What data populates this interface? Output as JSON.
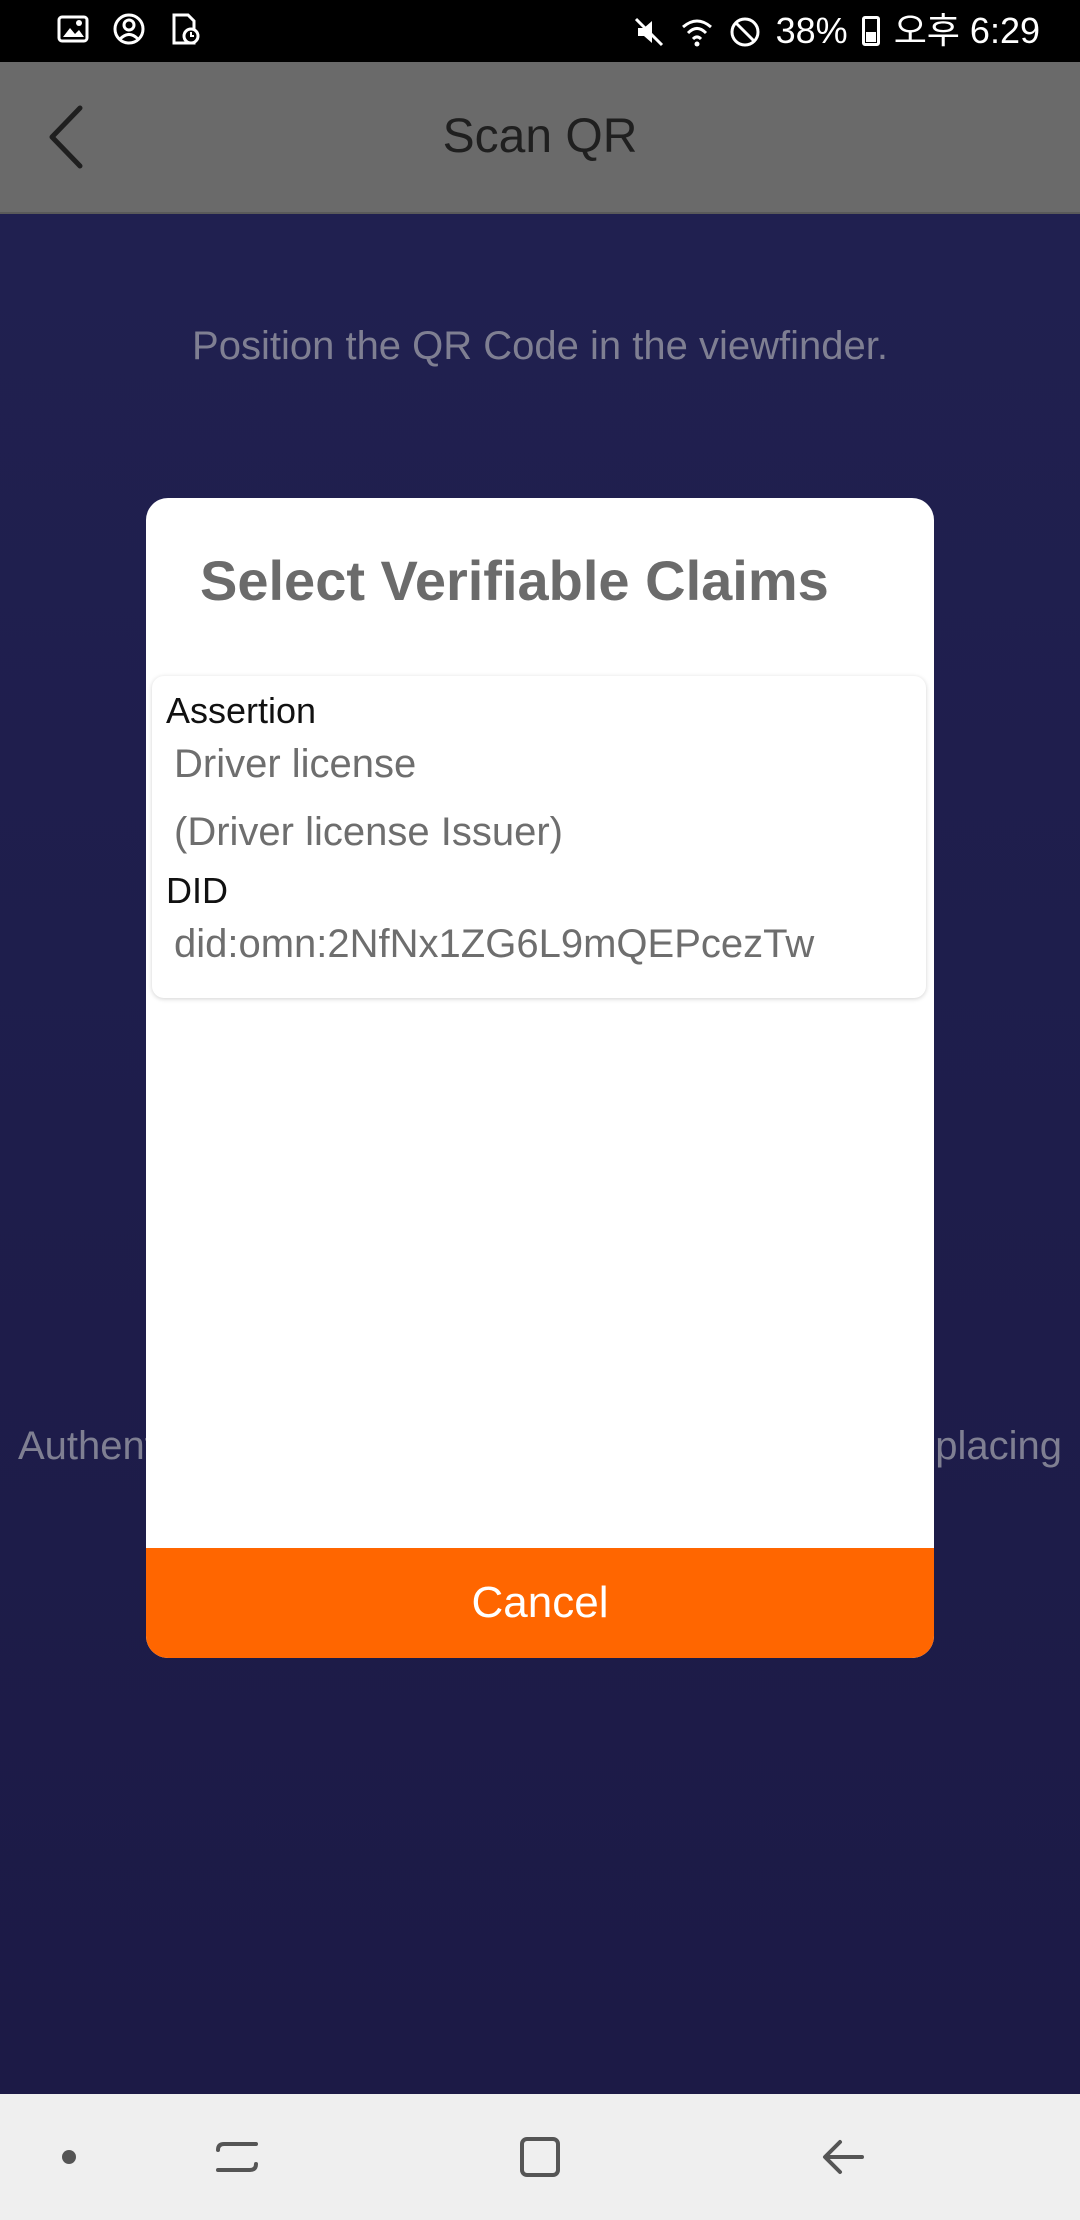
{
  "status_bar": {
    "battery": "38%",
    "time": "오후 6:29",
    "icons": [
      "gallery-icon",
      "account-circle-icon",
      "file-clock-icon",
      "mute-icon",
      "wifi-icon",
      "do-not-disturb-icon",
      "battery-icon"
    ]
  },
  "app_bar": {
    "title": "Scan QR",
    "back_icon": "chevron-left-icon"
  },
  "scanner": {
    "instruction": "Position the QR Code in the viewfinder.",
    "hint_left": "Authent",
    "hint_right": "placing"
  },
  "dialog": {
    "title": "Select Verifiable Claims",
    "claim": {
      "assertion_label": "Assertion",
      "assertion_value": "Driver license",
      "issuer": "(Driver license Issuer)",
      "did_label": "DID",
      "did_value": "did:omn:2NfNx1ZG6L9mQEPcezTw"
    },
    "cancel_label": "Cancel"
  },
  "nav_bar": {
    "items": [
      "dot-icon",
      "recent-apps-icon",
      "home-icon",
      "back-arrow-icon"
    ]
  },
  "colors": {
    "accent": "#ff6600",
    "app_bar": "#6a6a6a",
    "background": "#202050"
  }
}
